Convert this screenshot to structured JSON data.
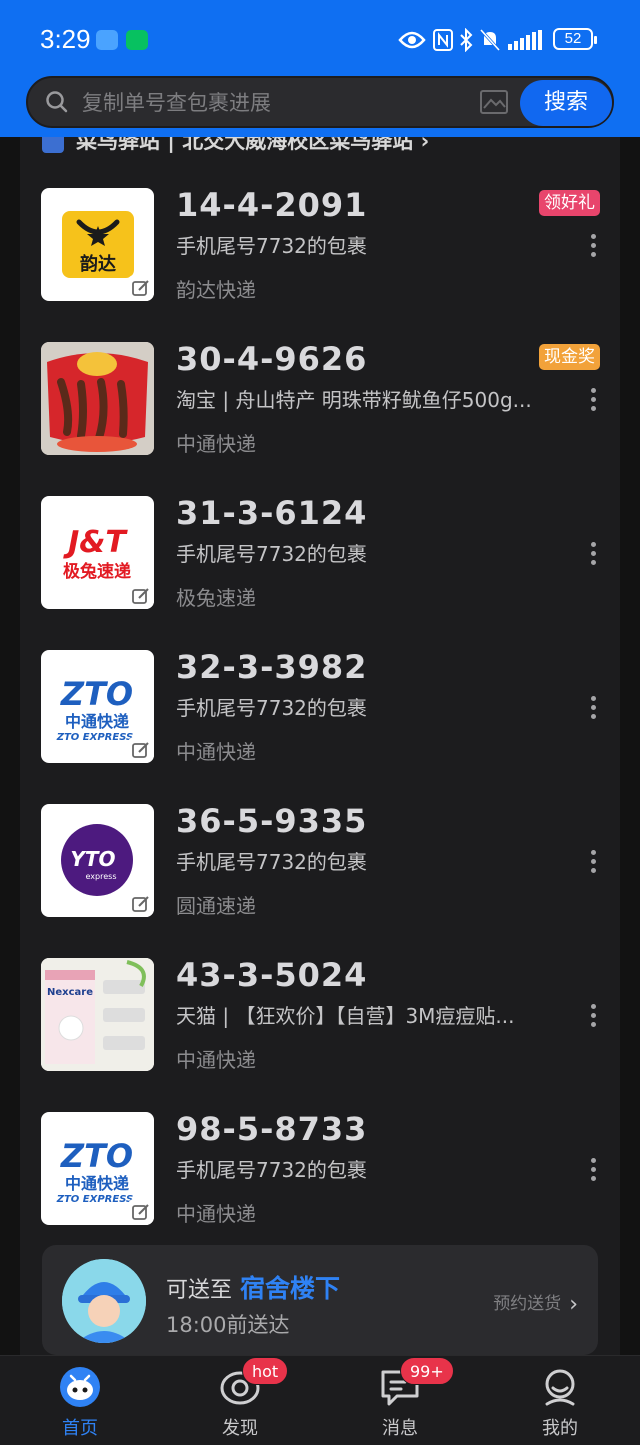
{
  "status_bar": {
    "time": "3:29",
    "battery": "52"
  },
  "search": {
    "placeholder": "复制单号查包裹进展",
    "button_label": "搜索"
  },
  "station_banner": {
    "text": "菜鸟驿站 | 北交大威海校区菜鸟驿站 ›"
  },
  "parcels": [
    {
      "code": "14-4-2091",
      "desc": "手机尾号7732的包裹",
      "carrier": "韵达快递",
      "tag": "领好礼",
      "tag_color": "#e8456c",
      "thumb": "yunda-logo"
    },
    {
      "code": "30-4-9626",
      "desc": "淘宝 | 舟山特产 明珠带籽鱿鱼仔500g...",
      "carrier": "中通快递",
      "tag": "现金奖",
      "tag_color": "#f2a23a",
      "thumb": "product-squid"
    },
    {
      "code": "31-3-6124",
      "desc": "手机尾号7732的包裹",
      "carrier": "极兔速递",
      "tag": "",
      "thumb": "jt-logo"
    },
    {
      "code": "32-3-3982",
      "desc": "手机尾号7732的包裹",
      "carrier": "中通快递",
      "tag": "",
      "thumb": "zto-logo"
    },
    {
      "code": "36-5-9335",
      "desc": "手机尾号7732的包裹",
      "carrier": "圆通速递",
      "tag": "",
      "thumb": "yto-logo"
    },
    {
      "code": "43-3-5024",
      "desc": "天猫 | 【狂欢价】【自营】3M痘痘贴...",
      "carrier": "中通快递",
      "tag": "",
      "thumb": "product-nexcare"
    },
    {
      "code": "98-5-8733",
      "desc": "手机尾号7732的包裹",
      "carrier": "中通快递",
      "tag": "",
      "thumb": "zto-logo"
    }
  ],
  "logos": {
    "yunda": "韵达",
    "jt_top": "J&T",
    "jt_bottom": "极兔速递",
    "zto_top": "ZTO",
    "zto_mid": "中通快递",
    "zto_bottom": "ZTO EXPRESS",
    "yto_top": "YTO",
    "yto_bottom": "express",
    "nexcare": "Nexcare"
  },
  "delivery_promo": {
    "prefix": "可送至",
    "place": "宿舍楼下",
    "time": "18:00前送达",
    "action": "预约送货"
  },
  "nav": {
    "items": [
      {
        "label": "首页",
        "active": true
      },
      {
        "label": "发现",
        "badge": "hot"
      },
      {
        "label": "消息",
        "badge": "99+"
      },
      {
        "label": "我的"
      }
    ]
  },
  "colors": {
    "accent": "#1168f0",
    "header": "#0f6ff2",
    "background": "#121212"
  }
}
